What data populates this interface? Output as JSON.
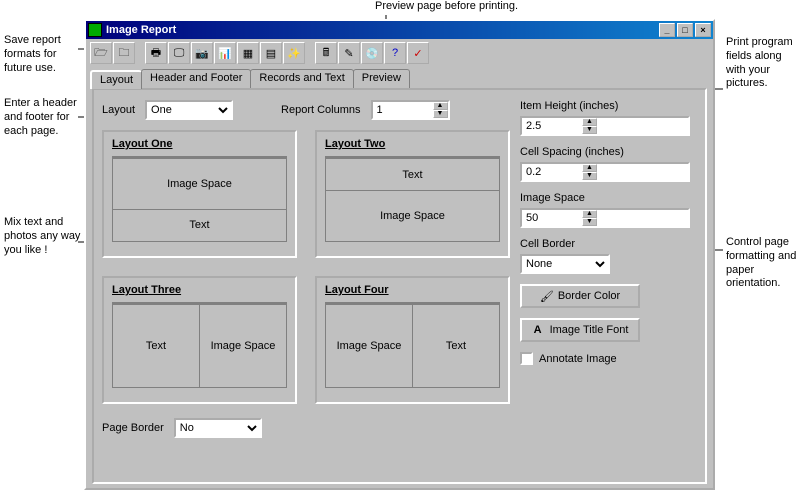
{
  "window": {
    "title": "Image Report"
  },
  "annotations": {
    "top_preview": "Preview page before printing.",
    "save_formats": "Save report formats for future use.",
    "print_fields": "Print program fields along with your pictures.",
    "header_footer": "Enter a header and footer for each page.",
    "mix_text": "Mix text and photos any way you like !",
    "control_format": "Control page formatting and paper orientation."
  },
  "tabs": {
    "layout": "Layout",
    "header_footer": "Header and Footer",
    "records_text": "Records and Text",
    "preview": "Preview"
  },
  "layout_panel": {
    "layout_label": "Layout",
    "layout_value": "One",
    "report_columns_label": "Report Columns",
    "report_columns_value": "1",
    "boxes": {
      "one": {
        "title": "Layout One",
        "a": "Image Space",
        "b": "Text"
      },
      "two": {
        "title": "Layout Two",
        "a": "Text",
        "b": "Image Space"
      },
      "three": {
        "title": "Layout Three",
        "a": "Text",
        "b": "Image Space"
      },
      "four": {
        "title": "Layout Four",
        "a": "Image Space",
        "b": "Text"
      }
    },
    "page_border_label": "Page Border",
    "page_border_value": "No"
  },
  "right": {
    "item_height_label": "Item Height (inches)",
    "item_height_value": "2.5",
    "cell_spacing_label": "Cell Spacing (inches)",
    "cell_spacing_value": "0.2",
    "image_space_label": "Image Space",
    "image_space_value": "50",
    "cell_border_label": "Cell Border",
    "cell_border_value": "None",
    "border_color_btn": "Border Color",
    "image_title_font_btn": "Image Title Font",
    "annotate_image_label": "Annotate Image"
  },
  "toolbar_icons": [
    "open-icon",
    "save-icon",
    "print-icon",
    "preview-icon",
    "camera-icon",
    "chart-icon",
    "table-icon",
    "grid-icon",
    "wizard-icon",
    "calc-icon",
    "edit-icon",
    "disc-icon",
    "help-icon",
    "apply-icon"
  ]
}
